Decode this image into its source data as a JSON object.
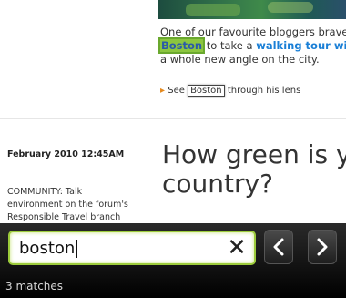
{
  "article": {
    "story_line1": "One of our favourite bloggers brave",
    "match_word": "Boston",
    "story_after_match": " to take a ",
    "walk_link": "walking tour with",
    "story_line3": "a whole new angle on the city.",
    "see_prefix": "See ",
    "see_match": "Boston",
    "see_suffix": " through his lens",
    "date": "February 2010 12:45AM",
    "community_lines": [
      "COMMUNITY: Talk",
      "environment on the forum's",
      "Responsible Travel branch"
    ],
    "headline_lines": [
      "How green is y",
      "country?"
    ]
  },
  "find_bar": {
    "query": "boston",
    "matches": "3 matches"
  },
  "icons": {
    "clear": "close-icon",
    "prev": "chevron-left-icon",
    "next": "chevron-right-icon",
    "arrow": "arrow-right-icon"
  },
  "colors": {
    "highlight_active": "#8cc63f",
    "field_border": "#9ccb3b",
    "link": "#1a7fd6"
  }
}
